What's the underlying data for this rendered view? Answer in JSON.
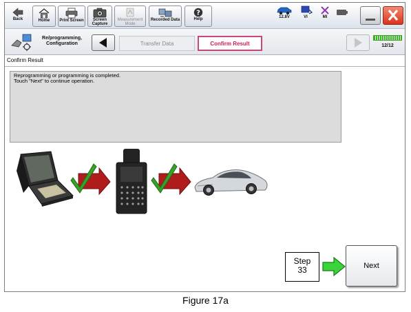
{
  "toolbar": {
    "back_label": "Back",
    "home_label": "Home",
    "print_label": "Print Screen",
    "capture_label": "Screen Capture",
    "measurement_label": "Measurement Mode",
    "recorded_label": "Recorded Data",
    "help_label": "Help",
    "voltage": "12.8V",
    "vi_label": "VI",
    "mi_label": "MI"
  },
  "breadcrumb": {
    "process_label": "Re/programming, Configuration",
    "steps": [
      "Transfer Data",
      "Confirm Result"
    ],
    "active_step": "Confirm Result",
    "progress": "12/12",
    "progress_fraction": 1.0
  },
  "page": {
    "title": "Confirm Result",
    "message_line1": "Reprogramming or programming is completed.",
    "message_line2": "Touch \"Next\" to continue operation."
  },
  "footer": {
    "step_label": "Step",
    "step_number": "33",
    "next_label": "Next"
  },
  "caption": "Figure 17a",
  "colors": {
    "active_tab": "#cc1d5a",
    "check_green": "#3aa02a",
    "arrow_red": "#b01c1c",
    "close_red": "#e5412e",
    "progress_green": "#2dbd1d"
  }
}
